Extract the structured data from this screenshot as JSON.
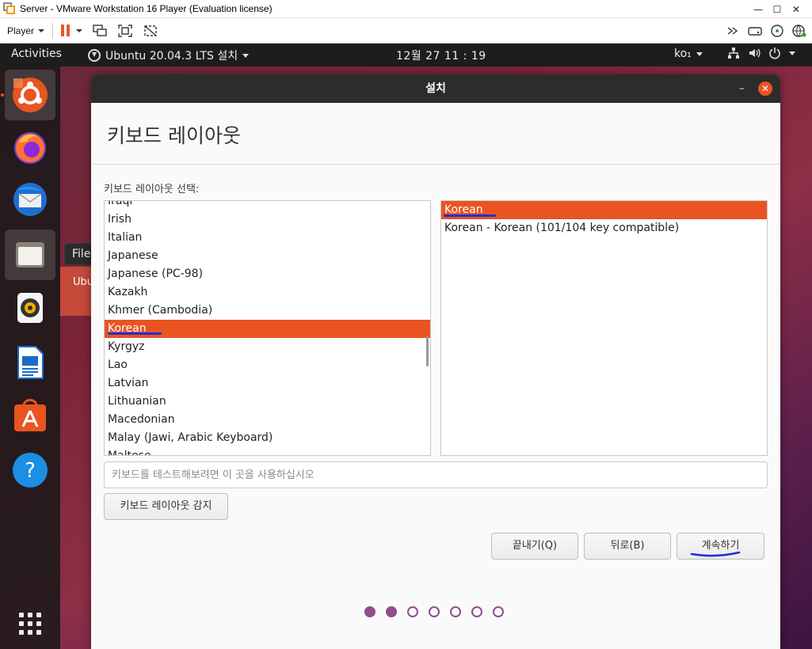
{
  "vmware": {
    "window_title": "Server - VMware Workstation 16 Player (Evaluation license)",
    "player_menu": "Player",
    "minimize_glyph": "—",
    "maximize_glyph": "☐",
    "close_glyph": "✕"
  },
  "topbar": {
    "activities": "Activities",
    "app_name": "Ubuntu 20.04.3 LTS 설치",
    "clock": "12월 27  11 : 19",
    "input_method": "ko₁"
  },
  "dock": {
    "tooltip": "Files",
    "behind_window_text": "Ubu"
  },
  "installer": {
    "window_title": "설치",
    "minimize_glyph": "–",
    "close_glyph": "✕",
    "page_title": "키보드 레이아웃",
    "layout_label": "키보드 레이아웃 선택:",
    "layouts": [
      {
        "label": "Iraqi",
        "selected": false
      },
      {
        "label": "Irish",
        "selected": false
      },
      {
        "label": "Italian",
        "selected": false
      },
      {
        "label": "Japanese",
        "selected": false
      },
      {
        "label": "Japanese (PC-98)",
        "selected": false
      },
      {
        "label": "Kazakh",
        "selected": false
      },
      {
        "label": "Khmer (Cambodia)",
        "selected": false
      },
      {
        "label": "Korean",
        "selected": true
      },
      {
        "label": "Kyrgyz",
        "selected": false
      },
      {
        "label": "Lao",
        "selected": false
      },
      {
        "label": "Latvian",
        "selected": false
      },
      {
        "label": "Lithuanian",
        "selected": false
      },
      {
        "label": "Macedonian",
        "selected": false
      },
      {
        "label": "Malay (Jawi, Arabic Keyboard)",
        "selected": false
      },
      {
        "label": "Maltese",
        "selected": false
      }
    ],
    "variants": [
      {
        "label": "Korean",
        "selected": true
      },
      {
        "label": "Korean - Korean (101/104 key compatible)",
        "selected": false
      }
    ],
    "test_placeholder": "키보드를 테스트해보려면 이 곳을 사용하십시오",
    "test_value": "",
    "detect_button": "키보드 레이아웃 감지",
    "quit_button": "끝내기(Q)",
    "back_button": "뒤로(B)",
    "continue_button": "계속하기",
    "steps_total": 7,
    "steps_completed": 2
  },
  "colors": {
    "ubuntu_orange": "#e95420",
    "step_dot_purple": "#924d8b",
    "annotation_blue": "#1f2fd6",
    "topbar_bg": "#1d1d1d",
    "installer_header_bg": "#2c2c2c"
  }
}
